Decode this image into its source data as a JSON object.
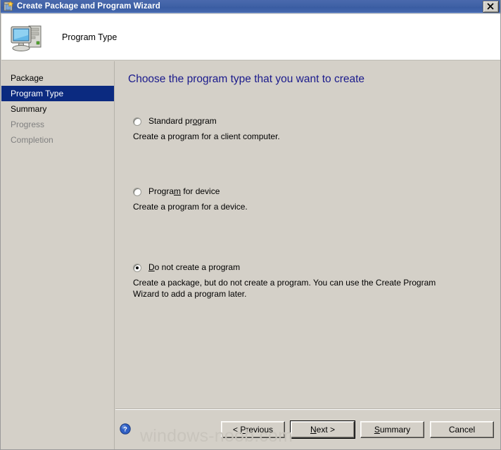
{
  "window": {
    "title": "Create Package and Program Wizard",
    "titlebar_icon": "package-star-icon",
    "close_label": "x",
    "accent_titlebar": "#4062a6",
    "background": "#d4d0c8"
  },
  "header": {
    "title": "Program Type",
    "icon": "computer-icon"
  },
  "sidebar": {
    "items": [
      {
        "label": "Package",
        "state": "done"
      },
      {
        "label": "Program Type",
        "state": "selected"
      },
      {
        "label": "Summary",
        "state": "done"
      },
      {
        "label": "Progress",
        "state": "disabled"
      },
      {
        "label": "Completion",
        "state": "disabled"
      }
    ],
    "selected_color": "#0b2a80"
  },
  "content": {
    "heading": "Choose the program type that you want to create",
    "heading_color": "#1a1a8c",
    "options": [
      {
        "label_before": "Standard pr",
        "label_accel": "o",
        "label_after": "gram",
        "label_full": "Standard program",
        "description": "Create a program for a client computer.",
        "checked": false
      },
      {
        "label_before": "Progra",
        "label_accel": "m",
        "label_after": " for device",
        "label_full": "Program for device",
        "description": "Create a program for a device.",
        "checked": false
      },
      {
        "label_before": "",
        "label_accel": "D",
        "label_after": "o not create a program",
        "label_full": "Do not create a program",
        "description": "Create a package, but do not create a program. You can use the Create Program Wizard to add a program later.",
        "checked": true
      }
    ]
  },
  "footer": {
    "help_icon": "help-question-icon",
    "buttons": [
      {
        "before": "< ",
        "accel": "P",
        "after": "revious",
        "full": "< Previous",
        "default": false
      },
      {
        "before": "",
        "accel": "N",
        "after": "ext >",
        "full": "Next >",
        "default": true
      },
      {
        "before": "",
        "accel": "S",
        "after": "ummary",
        "full": "Summary",
        "default": false
      },
      {
        "before": "Cancel",
        "accel": "",
        "after": "",
        "full": "Cancel",
        "default": false
      }
    ]
  },
  "watermark": {
    "text": "windows-noob.com"
  }
}
